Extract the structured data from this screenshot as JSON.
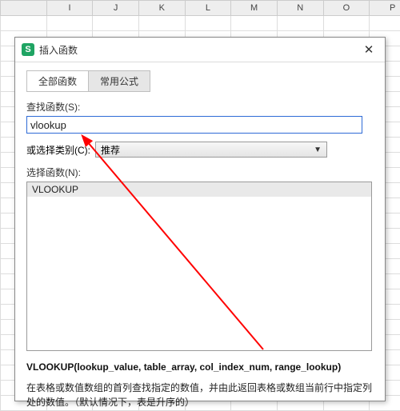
{
  "columns": [
    "",
    "I",
    "J",
    "K",
    "L",
    "M",
    "N",
    "O",
    "P"
  ],
  "dialog": {
    "title": "插入函数",
    "logo_letter": "S",
    "tabs": [
      {
        "label": "全部函数",
        "active": true
      },
      {
        "label": "常用公式",
        "active": false
      }
    ],
    "search_label": "查找函数(S):",
    "search_value": "vlookup",
    "category_label": "或选择类别(C):",
    "category_value": "推荐",
    "select_label": "选择函数(N):",
    "functions": [
      {
        "name": "VLOOKUP",
        "selected": true
      }
    ],
    "signature": "VLOOKUP(lookup_value, table_array, col_index_num, range_lookup)",
    "description": "在表格或数值数组的首列查找指定的数值，并由此返回表格或数组当前行中指定列处的数值。（默认情况下，表是升序的）"
  }
}
